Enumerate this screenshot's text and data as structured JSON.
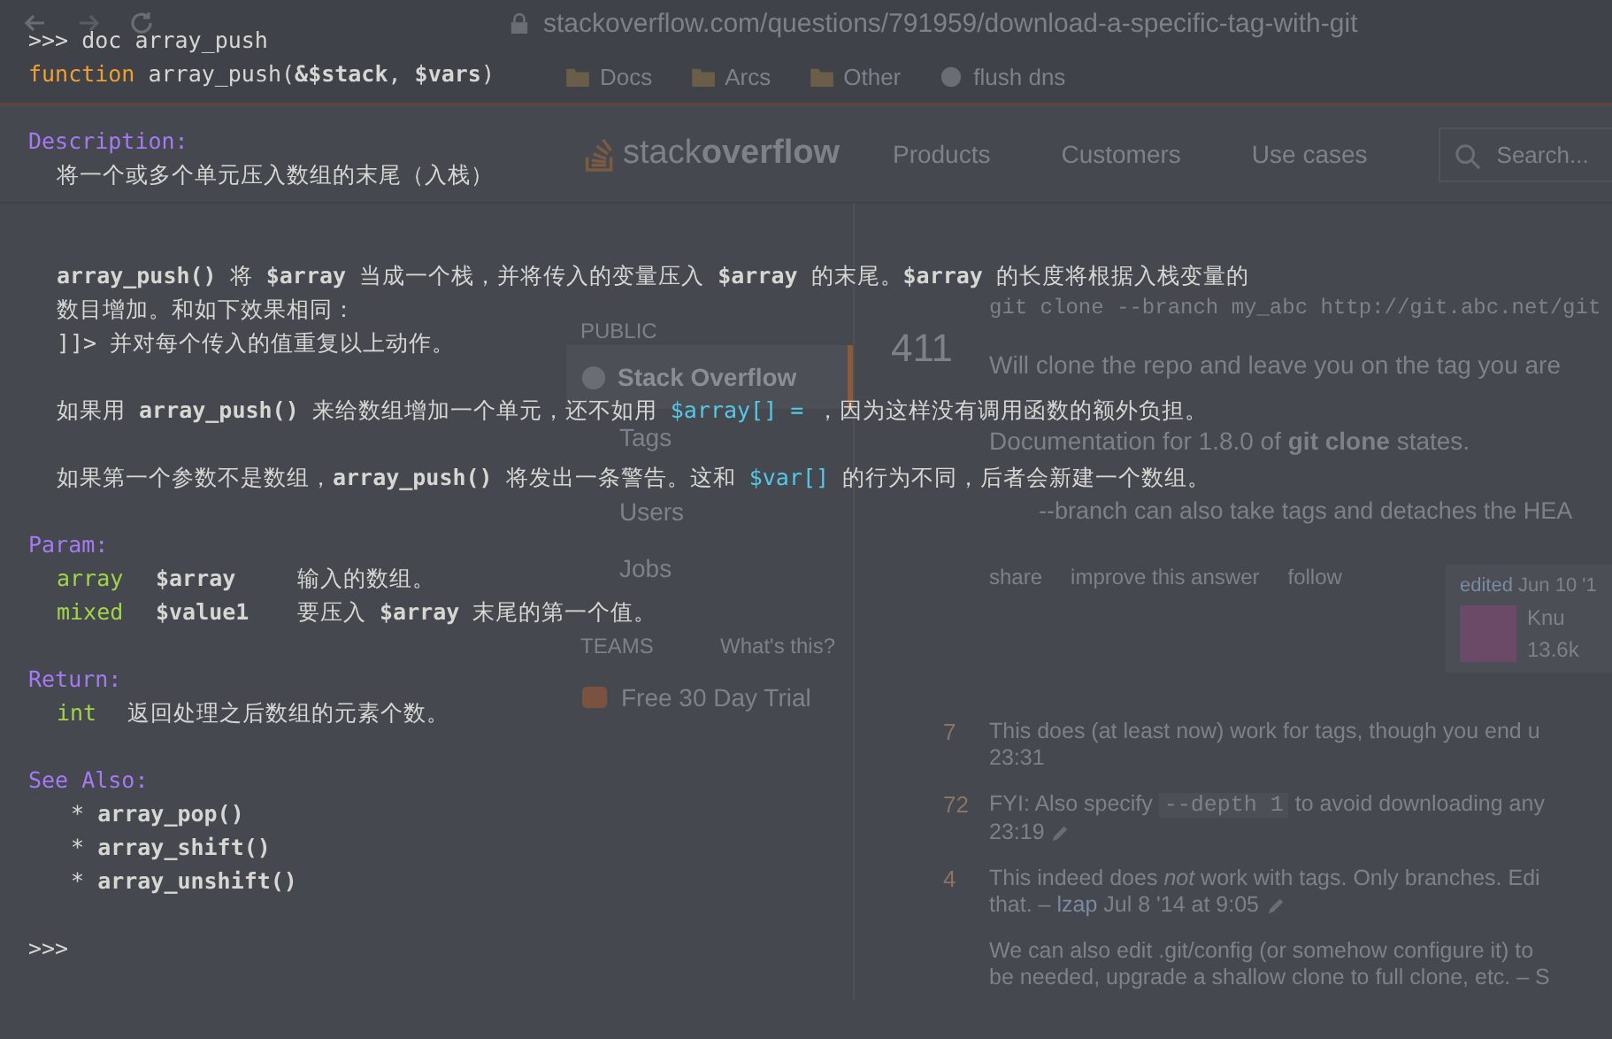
{
  "browser": {
    "url": "stackoverflow.com/questions/791959/download-a-specific-tag-with-git",
    "bookmarks": [
      {
        "label": "Docs",
        "kind": "folder"
      },
      {
        "label": "Arcs",
        "kind": "folder"
      },
      {
        "label": "Other",
        "kind": "folder"
      },
      {
        "label": "flush dns",
        "kind": "page"
      }
    ]
  },
  "site": {
    "logo": {
      "light": "stack",
      "bold": "overflow"
    },
    "nav": [
      {
        "label": "Products"
      },
      {
        "label": "Customers"
      },
      {
        "label": "Use cases"
      }
    ],
    "search": {
      "placeholder": "Search..."
    }
  },
  "sidebar": {
    "public_heading": "PUBLIC",
    "items": [
      {
        "label": "Stack Overflow",
        "selected": true
      },
      {
        "label": "Tags",
        "selected": false
      },
      {
        "label": "Users",
        "selected": false
      },
      {
        "label": "Jobs",
        "selected": false
      }
    ],
    "teams_heading": "TEAMS",
    "teams_link": "What's this?",
    "trial": "Free 30 Day Trial"
  },
  "answer": {
    "votes": "411",
    "code": "git clone --branch my_abc http://git.abc.net/git",
    "paragraphs": [
      "Will clone the repo and leave you on the tag you are",
      "Documentation for 1.8.0 of **git clone** states."
    ],
    "quote": "--branch can also take tags and detaches the HEA",
    "actions": [
      {
        "label": "share"
      },
      {
        "label": "improve this answer"
      },
      {
        "label": "follow"
      }
    ],
    "edit": {
      "label": "edited",
      "date": "Jun 10 '1"
    },
    "user": {
      "name": "Knu",
      "reputation": "13.6k"
    },
    "comments": [
      {
        "score": "7",
        "lines": [
          [
            {
              "kind": "text",
              "text": "This does (at least now) work for tags, though you end u"
            }
          ],
          [
            {
              "kind": "time",
              "text": "23:31"
            }
          ]
        ],
        "edited": false
      },
      {
        "score": "72",
        "lines": [
          [
            {
              "kind": "text",
              "text": "FYI: Also specify "
            },
            {
              "kind": "code",
              "text": "--depth 1"
            },
            {
              "kind": "text",
              "text": " to avoid downloading any"
            }
          ],
          [
            {
              "kind": "time",
              "text": "23:19"
            }
          ]
        ],
        "edited": true
      },
      {
        "score": "4",
        "lines": [
          [
            {
              "kind": "text",
              "text": "This indeed does *not* work with tags. Only branches. Edi"
            }
          ],
          [
            {
              "kind": "text",
              "text": "that. – "
            },
            {
              "kind": "user",
              "text": "lzap"
            },
            {
              "kind": "time",
              "text": " Jul 8 '14 at 9:05"
            }
          ]
        ],
        "edited": true
      },
      {
        "lines": [
          [
            {
              "kind": "text",
              "text": "We can also edit .git/config (or somehow configure it) to"
            }
          ],
          [
            {
              "kind": "text",
              "text": "be needed, upgrade a shallow clone to full clone, etc. – S"
            }
          ]
        ],
        "edited": false
      }
    ]
  },
  "terminal": {
    "command": {
      "prompt": ">>>",
      "text": "doc array_push"
    },
    "signature": {
      "keyword": "function",
      "text": "array_push(**&$stack**, **$vars**)"
    },
    "description": {
      "heading": "Description:",
      "summary": "将一个或多个单元压入数组的末尾（入栈）",
      "paragraphs": [
        [
          [
            {
              "kind": "text",
              "text": "**array_push()** 将 **$array** 当成一个栈，并将传入的变量压入 **$array** 的末尾。**$array** 的长度将根据入栈变量的"
            }
          ],
          [
            {
              "kind": "text",
              "text": "数目增加。和如下效果相同："
            }
          ],
          [
            {
              "kind": "text",
              "text": "]]> 并对每个传入的值重复以上动作。"
            }
          ]
        ],
        [
          [
            {
              "kind": "text",
              "text": "如果用 **array_push()** 来给数组增加一个单元，还不如用 "
            },
            {
              "kind": "code",
              "text": "$array[] ="
            },
            {
              "kind": "text",
              "text": " ，因为这样没有调用函数的额外负担。"
            }
          ]
        ],
        [
          [
            {
              "kind": "text",
              "text": "如果第一个参数不是数组，**array_push()** 将发出一条警告。这和 "
            },
            {
              "kind": "code",
              "text": "$var[]"
            },
            {
              "kind": "text",
              "text": " 的行为不同，后者会新建一个数组。"
            }
          ]
        ]
      ]
    },
    "params": {
      "heading": "Param:",
      "items": [
        {
          "type": "array",
          "name": "$array",
          "description": "输入的数组。"
        },
        {
          "type": "mixed",
          "name": "$value1",
          "description": "要压入 **$array** 末尾的第一个值。"
        }
      ]
    },
    "return": {
      "heading": "Return:",
      "type": "int",
      "description": "返回处理之后数组的元素个数。"
    },
    "see_also": {
      "heading": "See Also:",
      "items": [
        {
          "bullet": "*",
          "name": "array_pop()"
        },
        {
          "bullet": "*",
          "name": "array_shift()"
        },
        {
          "bullet": "*",
          "name": "array_unshift()"
        }
      ]
    },
    "final_prompt": ">>>"
  }
}
